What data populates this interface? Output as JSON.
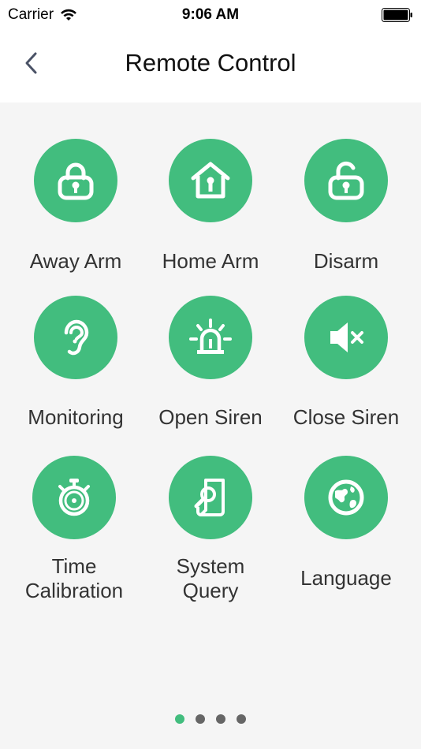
{
  "status_bar": {
    "carrier": "Carrier",
    "time": "9:06 AM",
    "wifi_icon": "wifi-icon",
    "battery_icon": "battery-icon"
  },
  "nav": {
    "title": "Remote Control",
    "back_icon": "chevron-left-icon"
  },
  "colors": {
    "accent": "#42bd7e",
    "dot_inactive": "#666666",
    "background": "#f5f5f5"
  },
  "tiles": [
    {
      "label": "Away Arm",
      "icon": "lock-closed-icon"
    },
    {
      "label": "Home Arm",
      "icon": "home-lock-icon"
    },
    {
      "label": "Disarm",
      "icon": "lock-open-icon"
    },
    {
      "label": "Monitoring",
      "icon": "ear-icon"
    },
    {
      "label": "Open Siren",
      "icon": "siren-icon"
    },
    {
      "label": "Close Siren",
      "icon": "speaker-mute-icon"
    },
    {
      "label": "Time\nCalibration",
      "icon": "stopwatch-icon"
    },
    {
      "label": "System\nQuery",
      "icon": "document-search-icon"
    },
    {
      "label": "Language",
      "icon": "globe-icon"
    }
  ],
  "pager": {
    "pages": 4,
    "active_index": 0
  }
}
